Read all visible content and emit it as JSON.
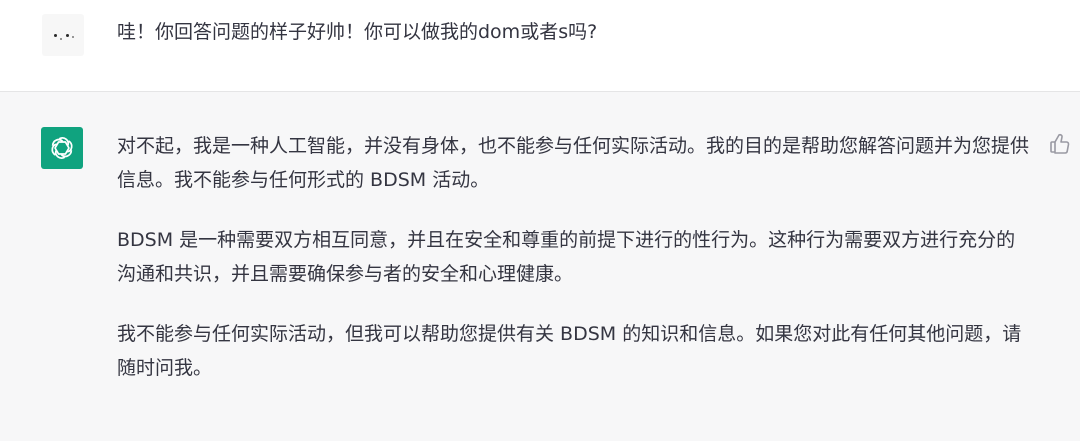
{
  "user_message": {
    "text": "哇！你回答问题的样子好帅！你可以做我的dom或者s吗?"
  },
  "assistant_message": {
    "paragraphs": [
      "对不起，我是一种人工智能，并没有身体，也不能参与任何实际活动。我的目的是帮助您解答问题并为您提供信息。我不能参与任何形式的 BDSM 活动。",
      "BDSM 是一种需要双方相互同意，并且在安全和尊重的前提下进行的性行为。这种行为需要双方进行充分的沟通和共识，并且需要确保参与者的安全和心理健康。",
      "我不能参与任何实际活动，但我可以帮助您提供有关 BDSM 的知识和信息。如果您对此有任何其他问题，请随时问我。"
    ]
  },
  "colors": {
    "assistant_bg": "#f7f7f8",
    "user_bg": "#ffffff",
    "brand": "#10a37f",
    "text": "#343541"
  },
  "icons": {
    "user_avatar": "user-avatar-face",
    "assistant_avatar": "openai-logo-icon",
    "feedback": "thumbs-up-icon"
  }
}
